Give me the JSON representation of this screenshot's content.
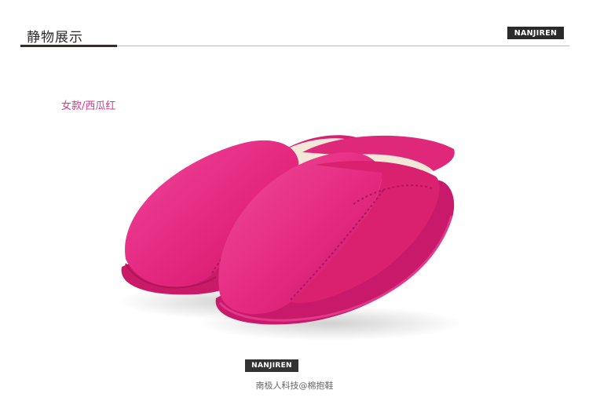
{
  "header": {
    "title": "静物展示",
    "brand": "NANJIREN"
  },
  "product": {
    "variant_label": "女款/西瓜红",
    "image_description_icon": "slipper-pair-photo",
    "colors": {
      "slipper": "#e3247a",
      "lining": "#f1e6d6",
      "sole": "#c81a66"
    }
  },
  "footer": {
    "brand": "NANJIREN",
    "caption": "南极人科技@棉抱鞋"
  },
  "colors": {
    "accent_rule": "#3a2a22",
    "variant_text": "#e0368c",
    "badge_bg": "#2a2a2a"
  }
}
